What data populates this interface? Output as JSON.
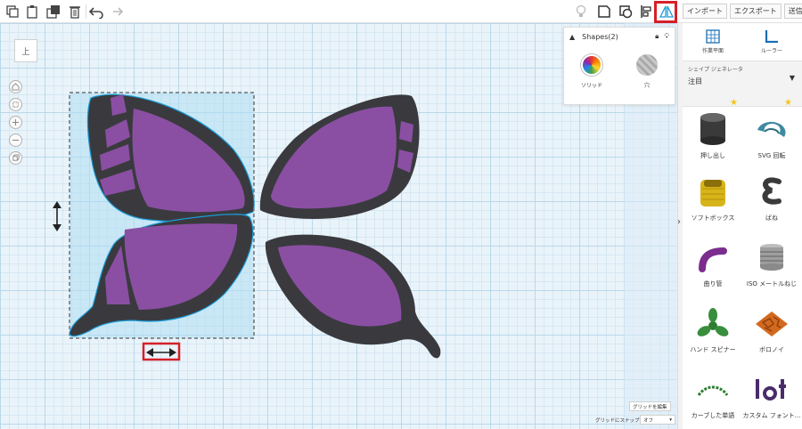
{
  "right_header": {
    "import_label": "インポート",
    "export_label": "エクスポート",
    "send_label": "送信先"
  },
  "viewcube": {
    "label": "上"
  },
  "inspector": {
    "title": "Shapes(2)",
    "solid_label": "ソリッド",
    "hole_label": "穴"
  },
  "tools": {
    "workplane_label": "作業平面",
    "ruler_label": "ルーラー"
  },
  "generator": {
    "label": "シェイプ ジェネレータ",
    "value": "注目"
  },
  "shapes": [
    {
      "label": "押し出し",
      "icon": "extrude-icon",
      "starred": true
    },
    {
      "label": "SVG 回転",
      "icon": "svg-revolve-icon",
      "starred": true
    },
    {
      "label": "ソフトボックス",
      "icon": "soft-box-icon",
      "starred": false
    },
    {
      "label": "ばね",
      "icon": "spring-icon",
      "starred": false
    },
    {
      "label": "曲り管",
      "icon": "bent-pipe-icon",
      "starred": false
    },
    {
      "label": "ISO メートルねじ",
      "icon": "iso-metric-thread-icon",
      "starred": false
    },
    {
      "label": "ハンド スピナー",
      "icon": "hand-spinner-icon",
      "starred": false
    },
    {
      "label": "ボロノイ",
      "icon": "voronoi-icon",
      "starred": false
    },
    {
      "label": "カーブした単語",
      "icon": "curved-word-icon",
      "starred": false
    },
    {
      "label": "カスタム フォント...",
      "icon": "custom-font-icon",
      "starred": false
    }
  ],
  "bottom": {
    "grid_edit_label": "グリッドを編集",
    "snap_label": "グリッドにスナップ",
    "snap_value": "オフ"
  },
  "colors": {
    "wing_purple": "#8a4fa3",
    "wing_dark": "#3a3a3e",
    "selection_blue": "#1a9bd7",
    "highlight_red": "#d62028"
  }
}
